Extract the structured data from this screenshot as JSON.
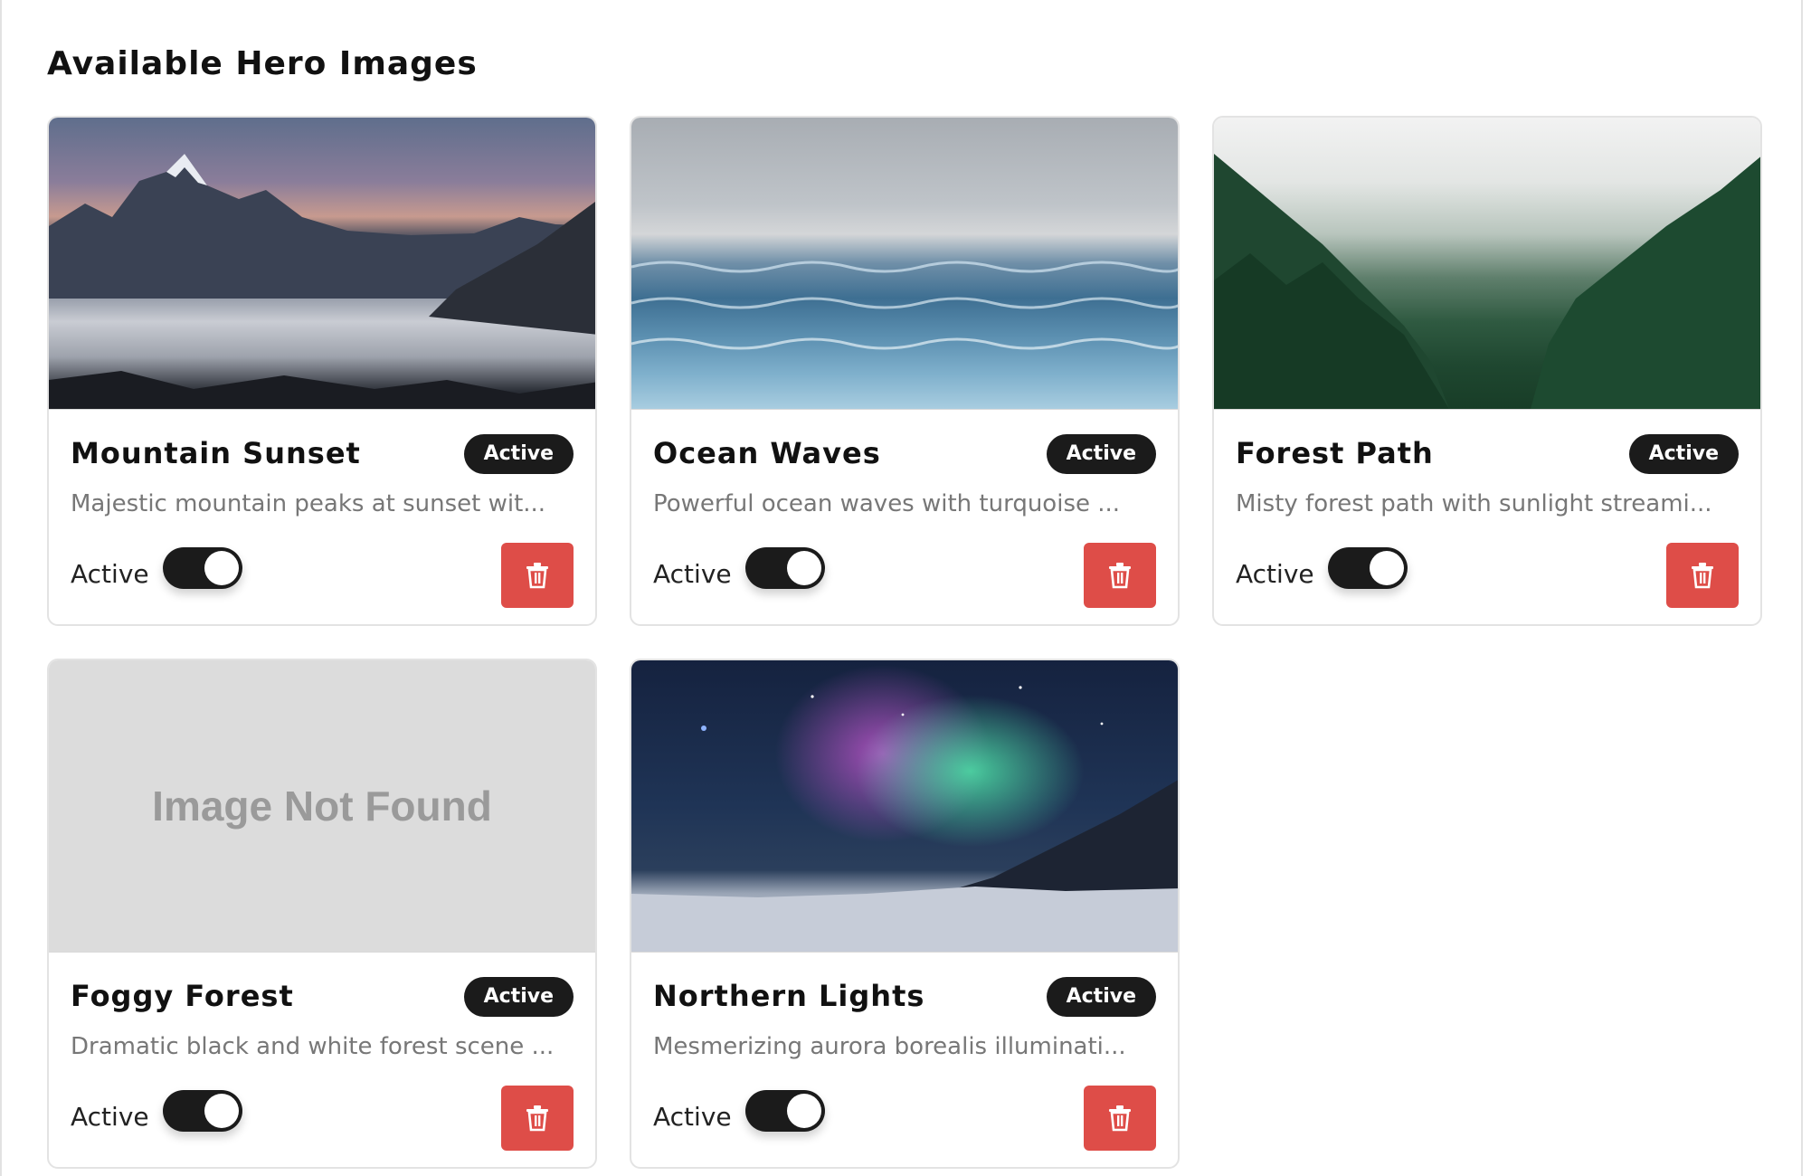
{
  "section": {
    "title": "Available Hero Images"
  },
  "cards": [
    {
      "title": "Mountain Sunset",
      "badge": "Active",
      "description": "Majestic mountain peaks at sunset wit...",
      "toggle_label": "Active",
      "toggle_on": true,
      "image": "mountain-sunset"
    },
    {
      "title": "Ocean Waves",
      "badge": "Active",
      "description": "Powerful ocean waves with turquoise ...",
      "toggle_label": "Active",
      "toggle_on": true,
      "image": "ocean-waves"
    },
    {
      "title": "Forest Path",
      "badge": "Active",
      "description": "Misty forest path with sunlight streami...",
      "toggle_label": "Active",
      "toggle_on": true,
      "image": "forest-path"
    },
    {
      "title": "Foggy Forest",
      "badge": "Active",
      "description": "Dramatic black and white forest scene ...",
      "toggle_label": "Active",
      "toggle_on": true,
      "image_missing_text": "Image Not Found"
    },
    {
      "title": "Northern Lights",
      "badge": "Active",
      "description": "Mesmerizing aurora borealis illuminati...",
      "toggle_label": "Active",
      "toggle_on": true,
      "image": "northern-lights"
    }
  ],
  "icons": {
    "delete": "trash-icon"
  },
  "colors": {
    "badge_bg": "#1b1b1b",
    "delete_bg": "#de4d48",
    "toggle_on": "#1b1b1b"
  }
}
